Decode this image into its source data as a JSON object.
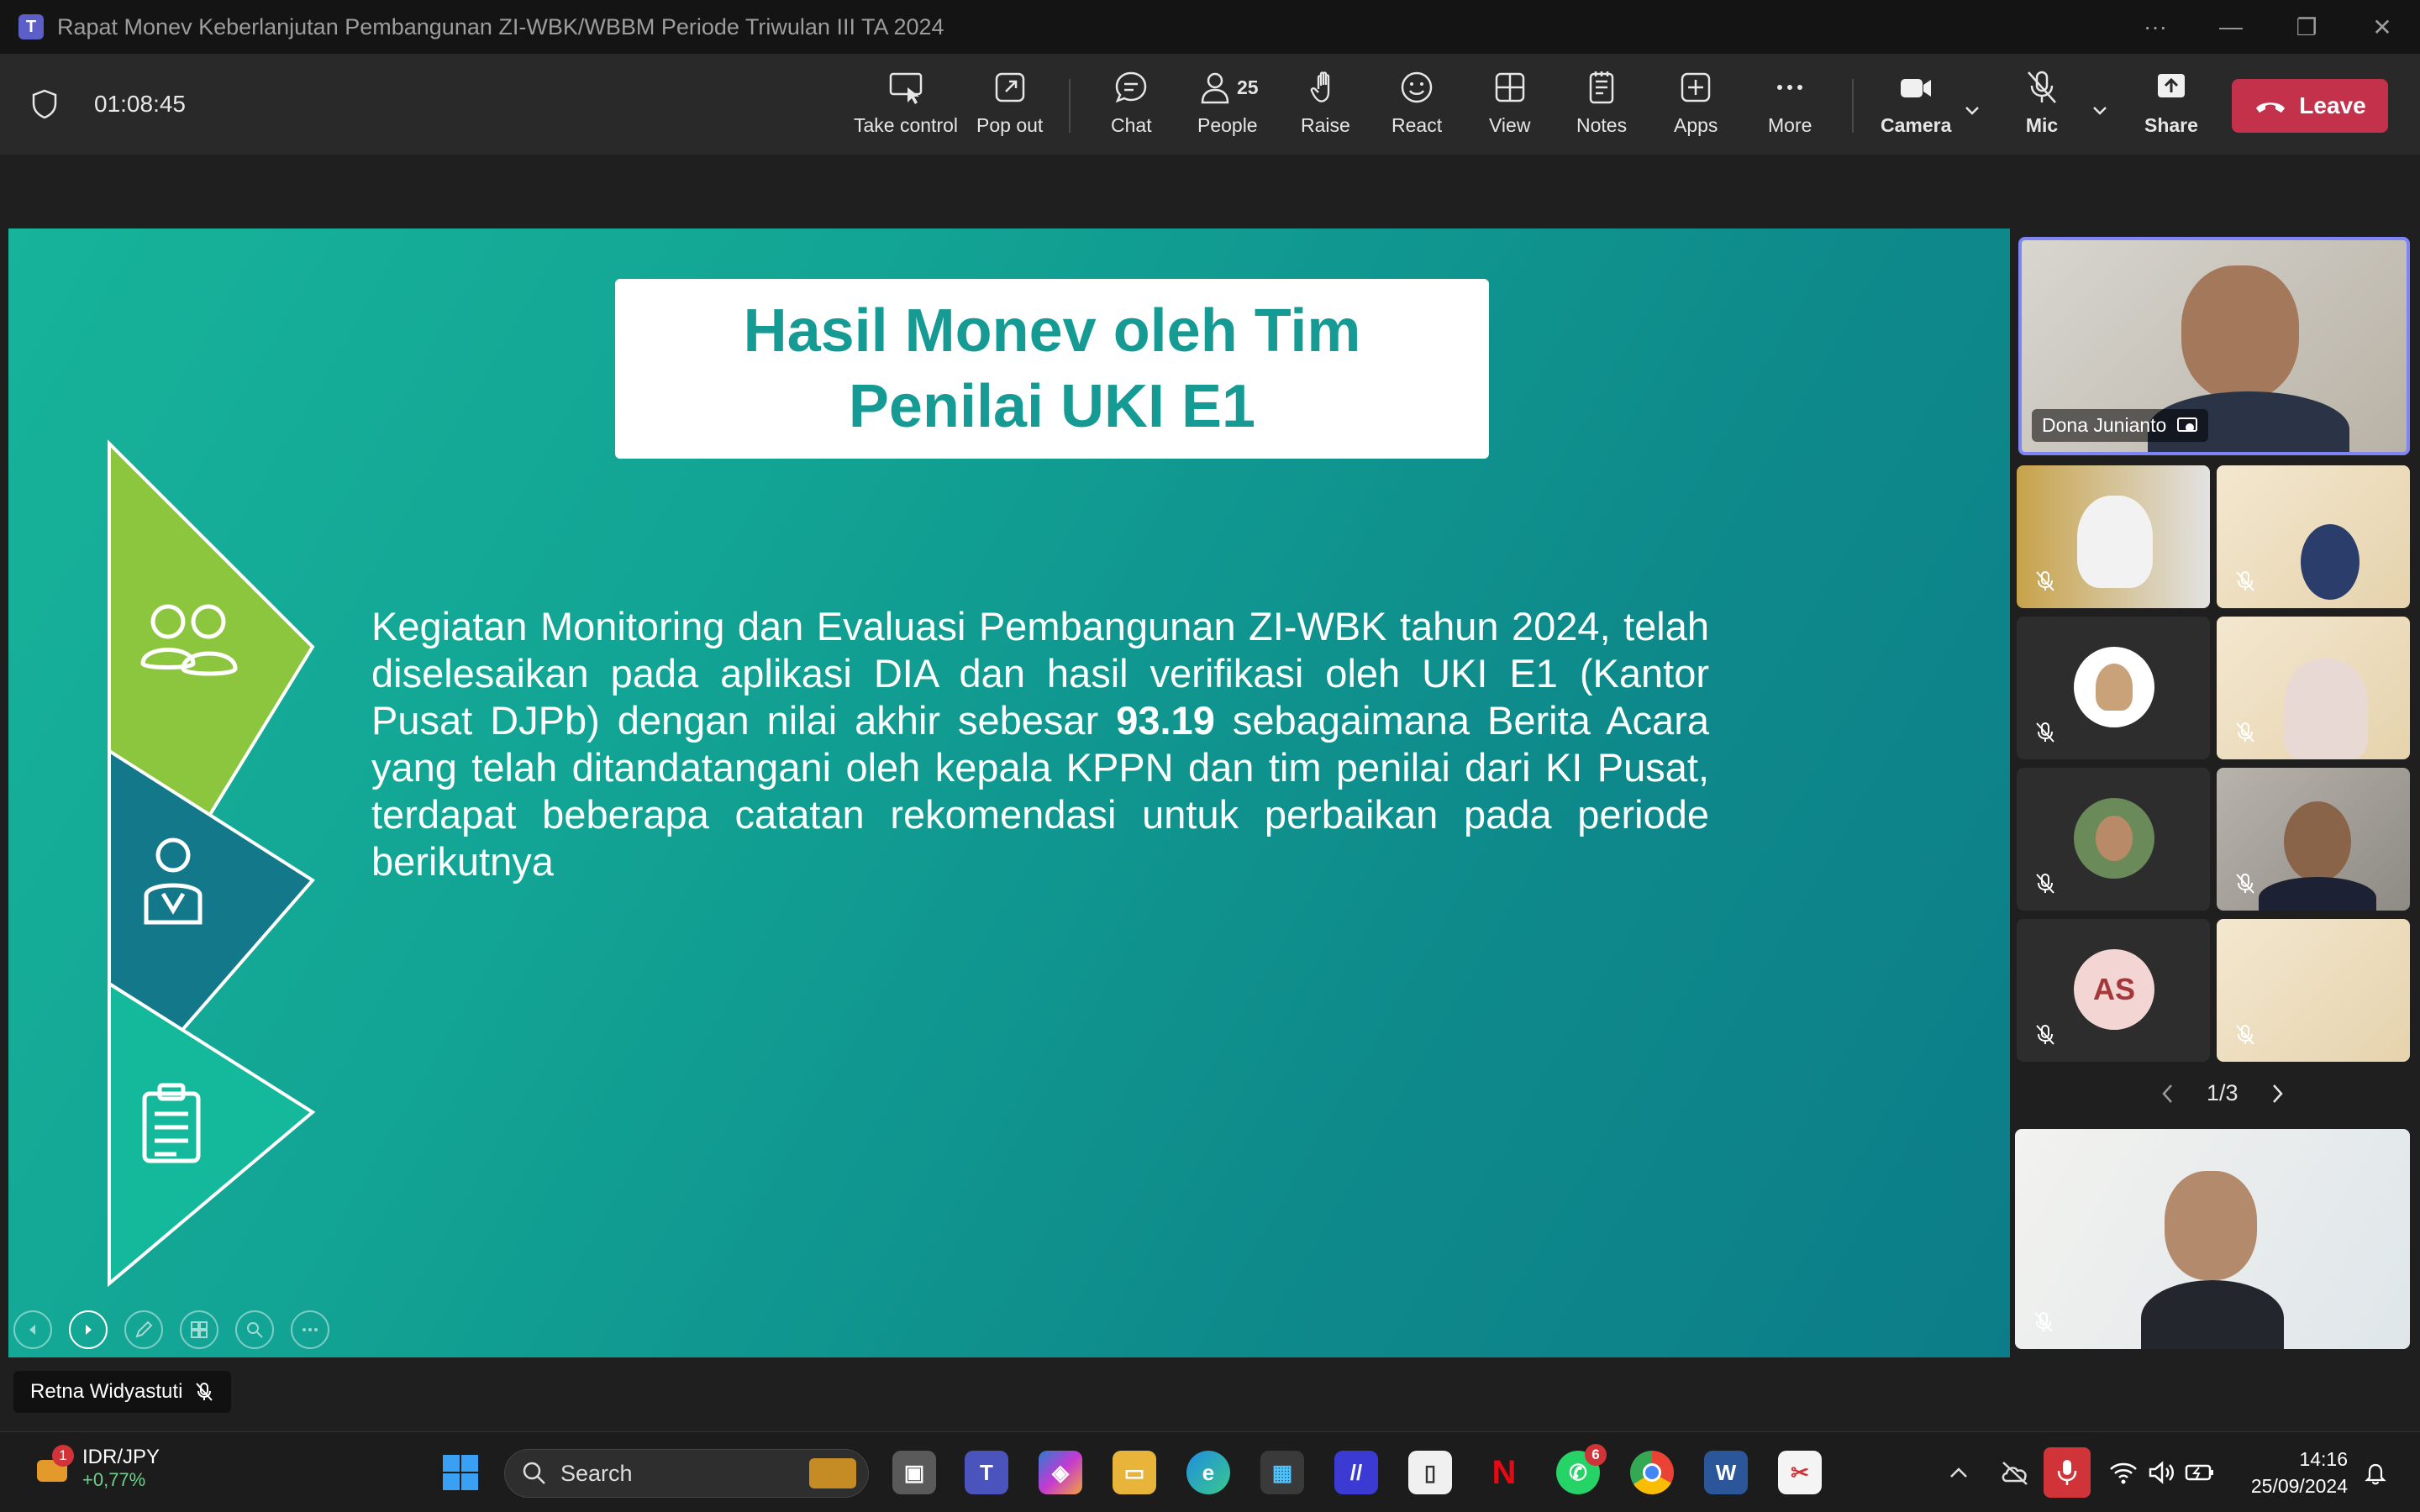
{
  "window": {
    "title": "Rapat Monev Keberlanjutan Pembangunan ZI-WBK/WBBM Periode Triwulan III TA 2024",
    "controls": [
      "···",
      "—",
      "❐",
      "✕"
    ]
  },
  "toolbar": {
    "timer": "01:08:45",
    "take_control": "Take control",
    "pop_out": "Pop out",
    "chat": "Chat",
    "people": "People",
    "people_count": "25",
    "raise": "Raise",
    "react": "React",
    "view": "View",
    "notes": "Notes",
    "apps": "Apps",
    "more": "More",
    "camera": "Camera",
    "mic": "Mic",
    "share": "Share",
    "leave": "Leave",
    "leave_color": "#c4314b"
  },
  "slide": {
    "title_line1": "Hasil Monev oleh Tim",
    "title_line2": "Penilai UKI E1",
    "body_part1": "Kegiatan Monitoring dan Evaluasi Pembangunan ZI-WBK tahun 2024, telah diselesaikan pada aplikasi DIA dan hasil verifikasi oleh UKI E1 (Kantor Pusat DJPb) dengan nilai akhir sebesar ",
    "body_score": "93.19",
    "body_part2": " sebagaimana Berita Acara yang telah ditandatangani oleh kepala KPPN dan tim penilai dari KI Pusat, terdapat beberapa catatan rekomendasi untuk perbaikan pada periode berikutnya",
    "colors": [
      "#8cc63f",
      "#13788a",
      "#14b89a"
    ]
  },
  "presenter_tag": "Retna Widyastuti",
  "gallery": {
    "speaker_name": "Dona Junianto",
    "avatar_initials": "AS",
    "page": "1/3"
  },
  "taskbar": {
    "ticker_symbol": "IDR/JPY",
    "ticker_change": "+0,77%",
    "ticker_badge": "1",
    "search_placeholder": "Search",
    "teams_badge": "",
    "whatsapp_badge": "6",
    "time": "14:16",
    "date": "25/09/2024"
  }
}
